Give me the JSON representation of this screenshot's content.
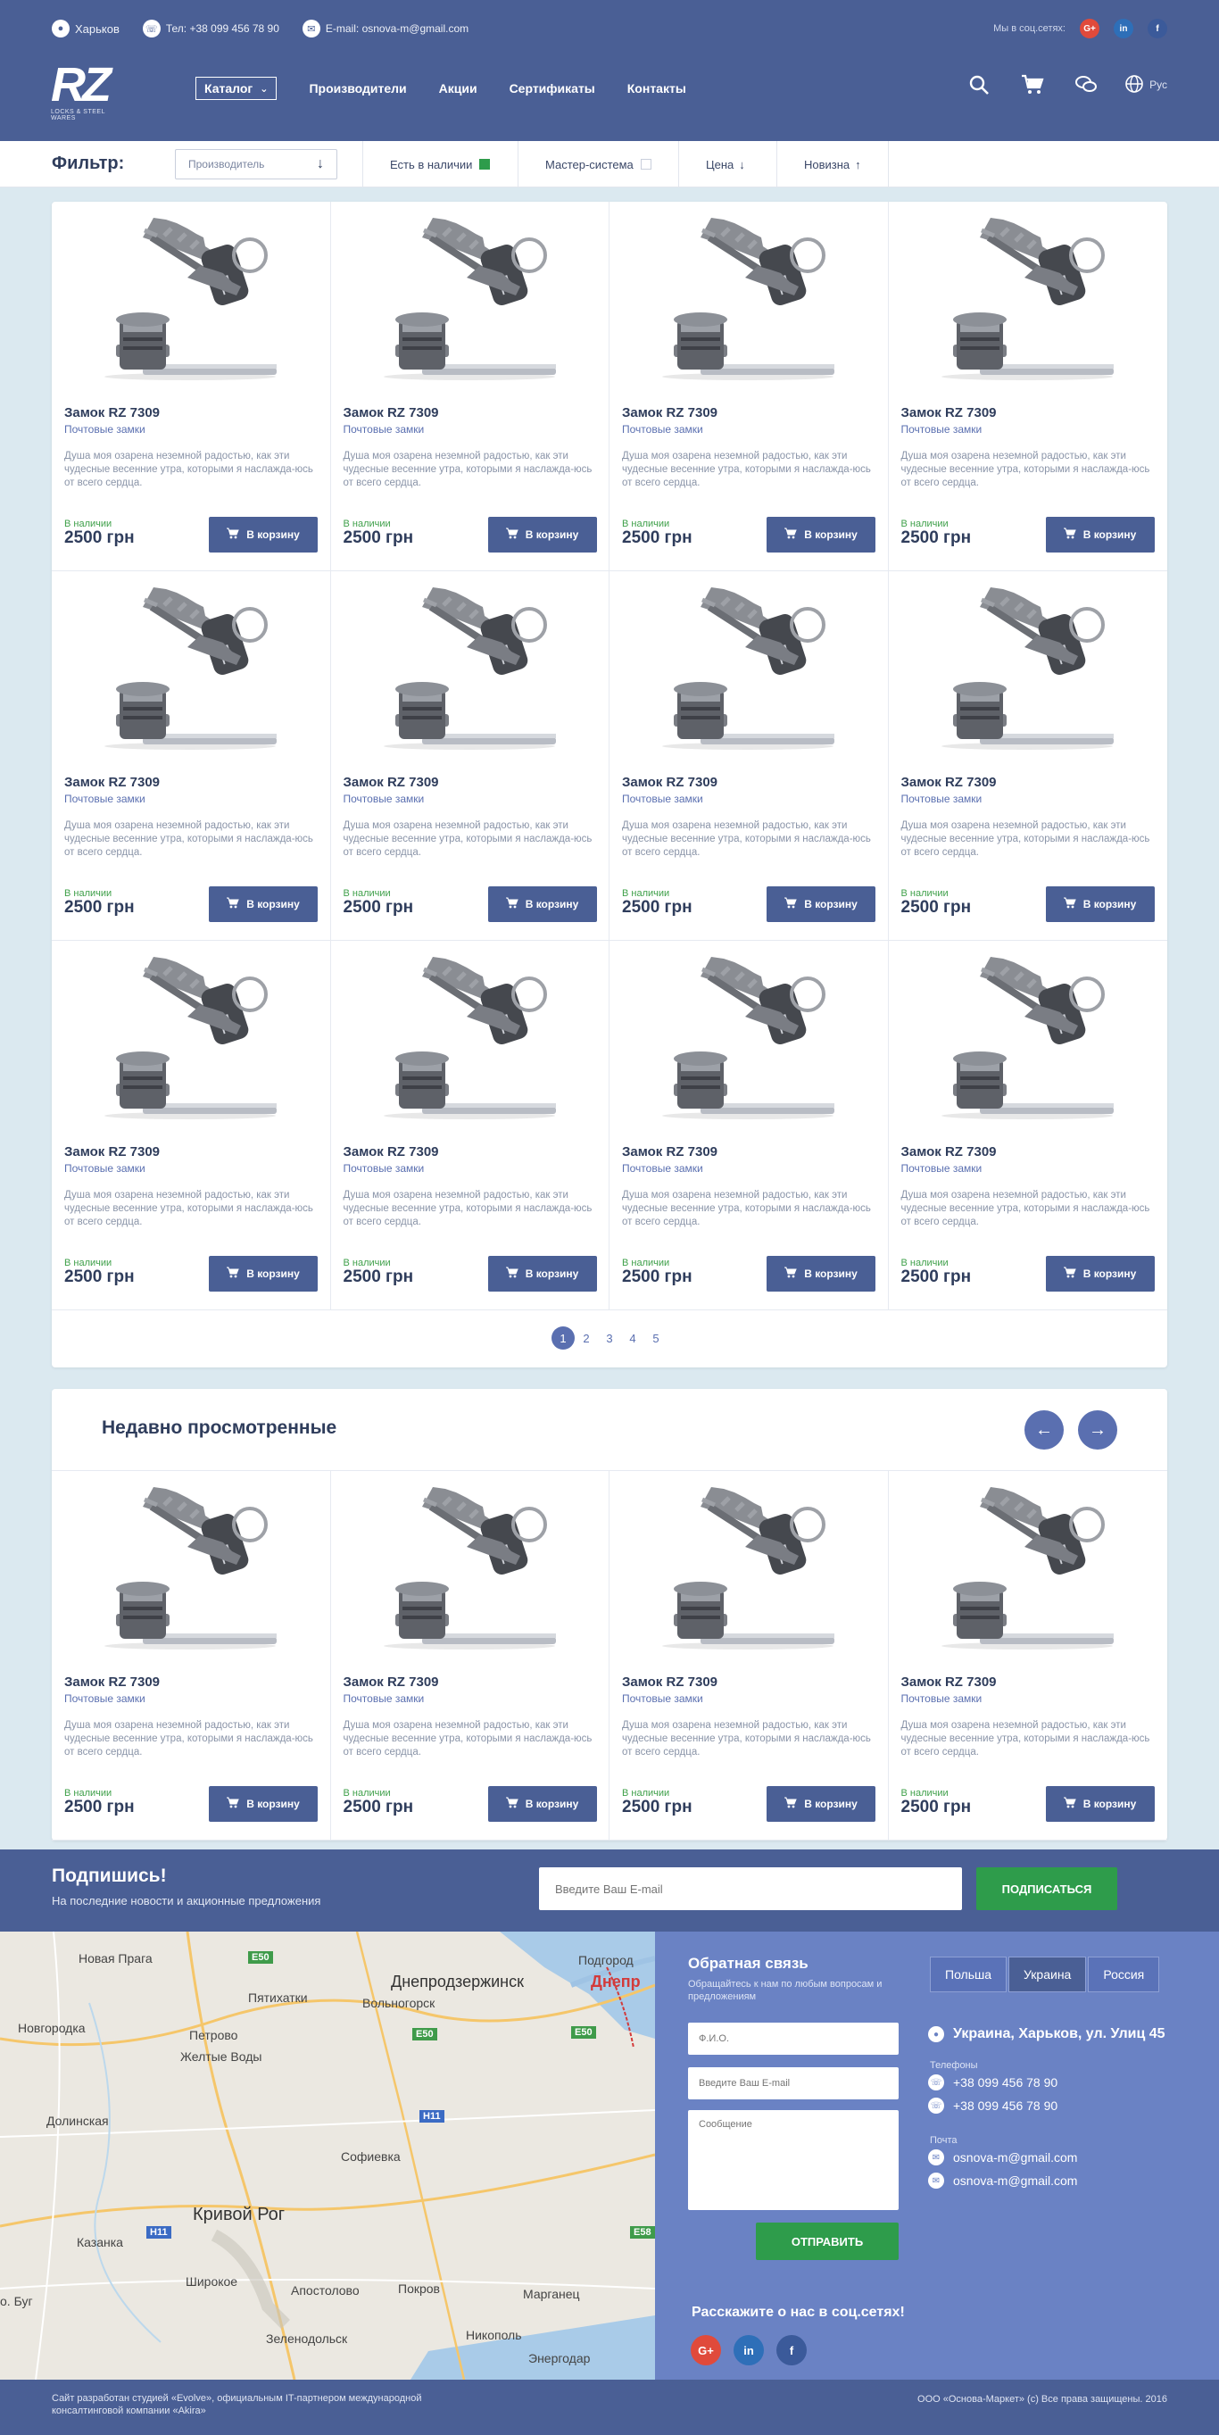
{
  "header": {
    "city": "Харьков",
    "phone": "Тел: +38 099 456 78 90",
    "email": "E-mail: osnova-m@gmail.com",
    "social_label": "Мы в соц.сетях:",
    "social": [
      "G+",
      "in",
      "f"
    ],
    "logo_text": "RZ",
    "logo_sub": "LOCKS & STEEL WARES",
    "nav": {
      "catalog": "Каталог",
      "items": [
        "Производители",
        "Акции",
        "Сертификаты",
        "Контакты"
      ]
    },
    "icons": [
      "search-icon",
      "cart-icon",
      "chat-icon",
      "globe-icon"
    ],
    "lang": "Рус",
    "colors": {
      "header_bg": "#4a5f95",
      "accent": "#5a6fb0",
      "green": "#2e9c4b",
      "page_bg": "#dbe9f0"
    }
  },
  "filter": {
    "title": "Фильтр:",
    "manufacturer_placeholder": "Производитель",
    "in_stock": "Есть в наличии",
    "master_system": "Мастер-система",
    "price": "Цена",
    "newest": "Новизна"
  },
  "product": {
    "name": "Замок RZ 7309",
    "category": "Почтовые замки",
    "description": "Душа моя озарена неземной радостью, как эти чудесные весенние утра, которыми я наслажда-юсь от всего сердца.",
    "stock": "В наличии",
    "price": "2500 грн",
    "buy_label": "В корзину"
  },
  "pagination": {
    "pages": [
      "1",
      "2",
      "3",
      "4",
      "5"
    ],
    "current": "1"
  },
  "recent": {
    "title": "Недавно просмотренные"
  },
  "subscribe": {
    "title": "Подпишись!",
    "text": "На последние новости и акционные предложения",
    "placeholder": "Введите Ваш E-mail",
    "button": "ПОДПИСАТЬСЯ"
  },
  "map": {
    "labels": [
      "Новая Прага",
      "E50",
      "Днепродзержинск",
      "Подгород",
      "Днепр",
      "Пятихатки",
      "Вольногорск",
      "Новгородка",
      "Петрово",
      "Желтые Воды",
      "E50",
      "E50",
      "Долинская",
      "H11",
      "Софиевка",
      "Кривой Рог",
      "Казанка",
      "H11",
      "E58",
      "Широкое",
      "Апостолово",
      "Покров",
      "Марганец",
      "Зеленодольск",
      "Никополь",
      "Энергодар",
      "о. Буг"
    ]
  },
  "contact": {
    "feedback_title": "Обратная связь",
    "feedback_sub": "Обращайтесь к нам по любым вопросам и предложениям",
    "name_placeholder": "Ф.И.О.",
    "email_placeholder": "Введите Ваш E-mail",
    "message_placeholder": "Сообщение",
    "send": "ОТПРАВИТЬ",
    "tell": "Расскажите о нас в соц.сетях!",
    "tabs": [
      "Польша",
      "Украина",
      "Россия"
    ],
    "active_tab": "Украина",
    "address": "Украина, Харьков, ул. Улиц 45",
    "phones_label": "Телефоны",
    "phones": [
      "+38 099 456 78 90",
      "+38 099 456 78 90"
    ],
    "mail_label": "Почта",
    "emails": [
      "osnova-m@gmail.com",
      "osnova-m@gmail.com"
    ]
  },
  "footer": {
    "left_1": "Сайт разработан студией «Evolve», официальным IT-партнером международной",
    "left_2": "консалтинговой компании «Akira»",
    "right": "ООО «Основа-Маркет» (с) Все права защищены. 2016"
  }
}
